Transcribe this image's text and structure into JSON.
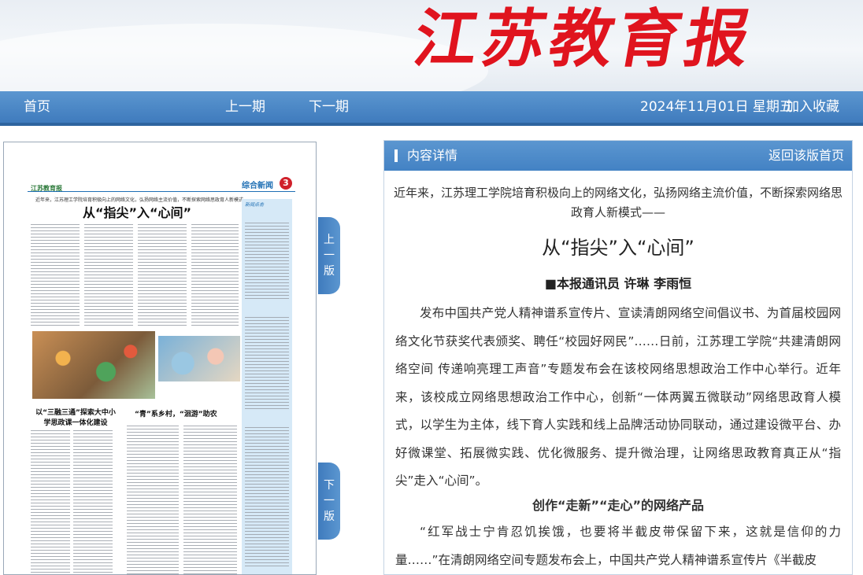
{
  "masthead": {
    "logo_chars": [
      "江",
      "苏",
      "教",
      "育",
      "报"
    ],
    "logo_color": "#e0141e"
  },
  "nav": {
    "home": "首页",
    "prev_issue": "上一期",
    "next_issue": "下一期",
    "date": "2024年11月01日 星期五",
    "favorite": "加入收藏"
  },
  "page_preview": {
    "brand": "江苏教育报",
    "section": "综合新闻",
    "page_number": "3",
    "intro": "近年来，江苏理工学院培育积极向上的网络文化，弘扬网络主流价值，不断探索网络思政育人新模式——",
    "headline": "从“指尖”入“心间”",
    "side_title": "新闻点击",
    "story2_title": "以“三融三通”探索大中小学思政课一体化建设",
    "story3_title": "“青”系乡村，“洄游”助农"
  },
  "tabs": {
    "prev_page": [
      "上",
      "一",
      "版"
    ],
    "next_page": [
      "下",
      "一",
      "版"
    ]
  },
  "article": {
    "panel_label": "内容详情",
    "back_label": "返回该版首页",
    "lead": "近年来，江苏理工学院培育积极向上的网络文化，弘扬网络主流价值，不断探索网络思政育人新模式——",
    "title": "从“指尖”入“心间”",
    "byline": "■本报通讯员  许琳  李雨恒",
    "paragraph1": "发布中国共产党人精神谱系宣传片、宣读清朗网络空间倡议书、为首届校园网络文化节获奖代表颁奖、聘任“校园好网民”……日前，江苏理工学院“共建清朗网络空间 传递响亮理工声音”专题发布会在该校网络思想政治工作中心举行。近年来，该校成立网络思想政治工作中心，创新“一体两翼五微联动”网络思政育人模式，以学生为主体，线下育人实践和线上品牌活动协同联动，通过建设微平台、办好微课堂、拓展微实践、优化微服务、提升微治理，让网络思政教育真正从“指尖”走入“心间”。",
    "subhead": "创作“走新”“走心”的网络产品",
    "paragraph2": "“红军战士宁肯忍饥挨饿，也要将半截皮带保留下来，这就是信仰的力量……”在清朗网络空间专题发布会上，中国共产党人精神谱系宣传片《半截皮"
  }
}
